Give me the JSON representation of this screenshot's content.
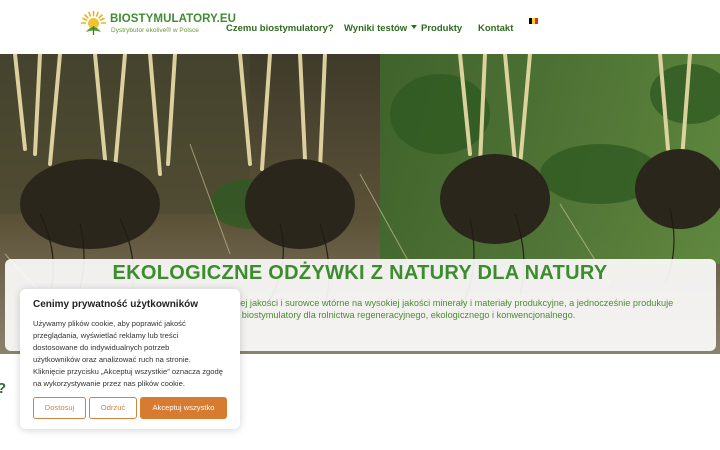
{
  "header": {
    "logo_title": "BIOSTYMULATORY.EU",
    "logo_subtitle": "Dystrybutor ekolive® w Polsce"
  },
  "nav": {
    "items": [
      {
        "label": "Czemu biostymulatory?"
      },
      {
        "label": "Wyniki testów",
        "has_dropdown": true
      },
      {
        "label": "Produkty"
      },
      {
        "label": "Kontakt"
      }
    ],
    "language_flag": [
      "#000000",
      "#f7d417",
      "#dd2b2b"
    ]
  },
  "banner": {
    "title": "EKOLOGICZNE ODŻYWKI Z NATURY DLA NATURY",
    "text_lines": [
      "skiej jakości i surowce wtórne na wysokiej jakości minerały i materiały produkcyjne, a jednocześnie produkuje",
      "ne biostymulatory dla rolnictwa regeneracyjnego, ekologicznego i konwencjonalnego."
    ]
  },
  "partial_heading": "?",
  "cookie": {
    "title": "Cenimy prywatność użytkowników",
    "body_lines": [
      "Używamy plików cookie, aby poprawić jakość",
      "przeglądania, wyświetlać reklamy lub treści",
      "dostosowane do indywidualnych potrzeb",
      "użytkowników oraz analizować ruch na stronie.",
      "Kliknięcie przycisku „Akceptuj wszystkie” oznacza zgodę",
      "na wykorzystywanie przez nas plików cookie."
    ],
    "buttons": {
      "customize": "Dostosuj",
      "reject": "Odrzuć",
      "accept_all": "Akceptuj wszystko"
    },
    "accent_color": "#d67b2f"
  },
  "colors": {
    "brand_green": "#3b8d2e",
    "nav_green": "#2e6b1f"
  }
}
